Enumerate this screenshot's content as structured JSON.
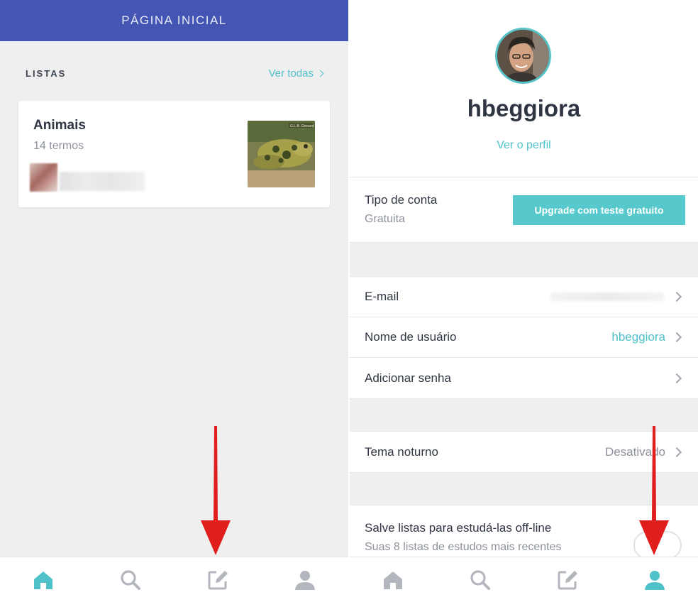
{
  "colors": {
    "brand_bar": "#4455b3",
    "accent": "#4fc1c9",
    "upgrade_button": "#57c8cb",
    "arrow": "#e01e1e",
    "nav_active": "#4fc1c9",
    "nav_inactive": "#b3b6bc"
  },
  "left": {
    "header_title": "PÁGINA INICIAL",
    "section": {
      "title": "LISTAS",
      "see_all": "Ver todas"
    },
    "list_card": {
      "title": "Animais",
      "subtitle": "14 termos",
      "image_watermark": "G.L.B. Ginnard"
    },
    "bottom_nav": [
      {
        "icon": "home-icon",
        "active": true
      },
      {
        "icon": "search-icon",
        "active": false
      },
      {
        "icon": "edit-icon",
        "active": false
      },
      {
        "icon": "profile-icon",
        "active": false
      }
    ]
  },
  "right": {
    "username": "hbeggiora",
    "view_profile": "Ver o perfil",
    "account": {
      "label": "Tipo de conta",
      "value": "Gratuita",
      "upgrade_button": "Upgrade com teste gratuito"
    },
    "settings": {
      "email_label": "E-mail",
      "username_label": "Nome de usuário",
      "username_value": "hbeggiora",
      "password_label": "Adicionar senha"
    },
    "night_theme": {
      "label": "Tema noturno",
      "value": "Desativado"
    },
    "offline": {
      "title": "Salve listas para estudá-las off-line",
      "subtitle": "Suas 8 listas de estudos mais recentes"
    },
    "bottom_nav": [
      {
        "icon": "home-icon",
        "active": false
      },
      {
        "icon": "search-icon",
        "active": false
      },
      {
        "icon": "edit-icon",
        "active": false
      },
      {
        "icon": "profile-icon",
        "active": true
      }
    ]
  }
}
